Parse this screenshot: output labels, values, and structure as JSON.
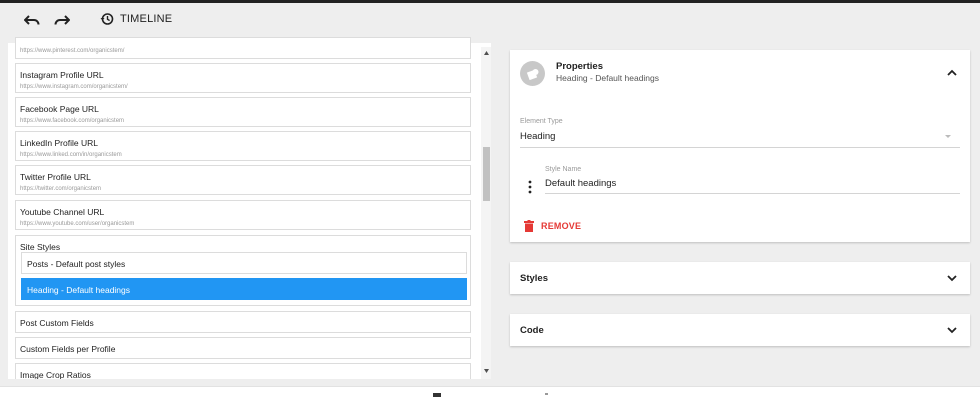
{
  "toolbar": {
    "undo_icon": "undo-icon",
    "redo_icon": "redo-icon",
    "timeline_icon": "history-icon",
    "timeline_label": "TIMELINE"
  },
  "fields": [
    {
      "title": "",
      "subtitle": "https://www.pinterest.com/organicstem/"
    },
    {
      "title": "Instagram Profile URL",
      "subtitle": "https://www.instagram.com/organicstem/"
    },
    {
      "title": "Facebook Page URL",
      "subtitle": "https://www.facebook.com/organicstem"
    },
    {
      "title": "LinkedIn Profile URL",
      "subtitle": "https://www.linked.com/in/organicstem"
    },
    {
      "title": "Twitter Profile URL",
      "subtitle": "https://twitter.com/organicstem"
    },
    {
      "title": "Youtube Channel URL",
      "subtitle": "https://www.youtube.com/user/organicstem"
    }
  ],
  "site_styles": {
    "title": "Site Styles",
    "items": [
      {
        "label": "Posts - Default post styles"
      },
      {
        "label": "Heading - Default headings"
      }
    ]
  },
  "more_fields": [
    {
      "title": "Post Custom Fields"
    },
    {
      "title": "Custom Fields per Profile"
    },
    {
      "title": "Image Crop Ratios"
    }
  ],
  "properties": {
    "title": "Properties",
    "subtitle": "Heading - Default headings",
    "element_type_label": "Element Type",
    "element_type_value": "Heading",
    "style_name_label": "Style Name",
    "style_name_value": "Default headings",
    "remove_label": "REMOVE"
  },
  "styles_card": {
    "title": "Styles"
  },
  "code_card": {
    "title": "Code"
  },
  "colors": {
    "accent": "#2196f3",
    "danger": "#e53935",
    "background": "#eeeeee"
  }
}
